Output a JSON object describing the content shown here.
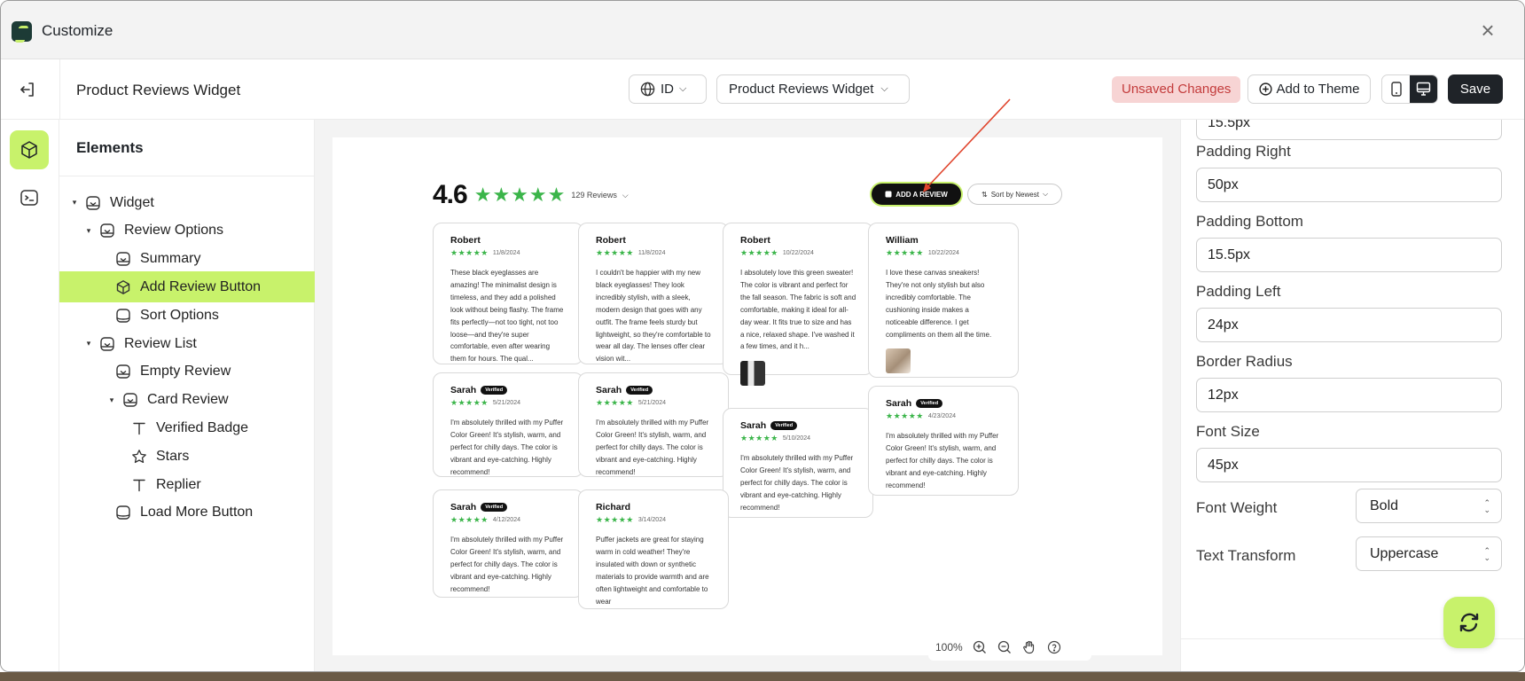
{
  "window": {
    "title": "Customize"
  },
  "header": {
    "widget_title": "Product Reviews Widget",
    "language": "ID",
    "widget_select": "Product Reviews Widget",
    "unsaved_label": "Unsaved Changes",
    "add_to_theme_label": "Add to Theme",
    "save_label": "Save"
  },
  "elements_panel": {
    "title": "Elements",
    "items": [
      {
        "label": "Widget",
        "level": 0,
        "expandable": true,
        "icon": "widget-icon"
      },
      {
        "label": "Review Options",
        "level": 1,
        "expandable": true,
        "icon": "widget-icon"
      },
      {
        "label": "Summary",
        "level": 2,
        "expandable": false,
        "icon": "widget-icon"
      },
      {
        "label": "Add Review Button",
        "level": 2,
        "expandable": false,
        "icon": "cube-icon",
        "selected": true
      },
      {
        "label": "Sort Options",
        "level": 2,
        "expandable": false,
        "icon": "container-icon"
      },
      {
        "label": "Review List",
        "level": 1,
        "expandable": true,
        "icon": "widget-icon"
      },
      {
        "label": "Empty Review",
        "level": 2,
        "expandable": false,
        "icon": "widget-icon"
      },
      {
        "label": "Card Review",
        "level": 2,
        "expandable": true,
        "icon": "widget-icon"
      },
      {
        "label": "Verified Badge",
        "level": 3,
        "expandable": false,
        "icon": "text-icon"
      },
      {
        "label": "Stars",
        "level": 3,
        "expandable": false,
        "icon": "star-icon"
      },
      {
        "label": "Replier",
        "level": 3,
        "expandable": false,
        "icon": "text-icon"
      },
      {
        "label": "Load More Button",
        "level": 2,
        "expandable": false,
        "icon": "container-icon"
      }
    ]
  },
  "preview": {
    "rating": "4.6",
    "stars": "★★★★★",
    "reviews_count": "129 Reviews",
    "add_review_label": "ADD A REVIEW",
    "sort_label": "Sort by Newest",
    "verified_label": "Verified",
    "cards": [
      {
        "name": "Robert",
        "stars": "★★★★★",
        "date": "11/8/2024",
        "verified": false,
        "body": "These black eyeglasses are amazing! The minimalist design is timeless, and they add a polished look without being flashy. The frame fits perfectly—not too tight, not too loose—and they're super comfortable, even after wearing them for hours. The qual..."
      },
      {
        "name": "Robert",
        "stars": "★★★★★",
        "date": "11/8/2024",
        "verified": false,
        "body": "I couldn't be happier with my new black eyeglasses! They look incredibly stylish, with a sleek, modern design that goes with any outfit. The frame feels sturdy but lightweight, so they're comfortable to wear all day. The lenses offer clear vision wit..."
      },
      {
        "name": "Robert",
        "stars": "★★★★★",
        "date": "10/22/2024",
        "verified": false,
        "body": "I absolutely love this green sweater! The color is vibrant and perfect for the fall season. The fabric is soft and comfortable, making it ideal for all-day wear. It fits true to size and has a nice, relaxed shape. I've washed it a few times, and it h..."
      },
      {
        "name": "William",
        "stars": "★★★★★",
        "date": "10/22/2024",
        "verified": false,
        "body": "I love these canvas sneakers! They're not only stylish but also incredibly comfortable. The cushioning inside makes a noticeable difference. I get compliments on them all the time."
      },
      {
        "name": "Sarah",
        "stars": "★★★★★",
        "date": "5/21/2024",
        "verified": true,
        "body": "I'm absolutely thrilled with my Puffer Color Green! It's stylish, warm, and perfect for chilly days. The color is vibrant and eye-catching. Highly recommend!"
      },
      {
        "name": "Sarah",
        "stars": "★★★★★",
        "date": "5/21/2024",
        "verified": true,
        "body": "I'm absolutely thrilled with my Puffer Color Green! It's stylish, warm, and perfect for chilly days. The color is vibrant and eye-catching. Highly recommend!"
      },
      {
        "name": "Sarah",
        "stars": "★★★★★",
        "date": "5/10/2024",
        "verified": true,
        "body": "I'm absolutely thrilled with my Puffer Color Green! It's stylish, warm, and perfect for chilly days. The color is vibrant and eye-catching. Highly recommend!"
      },
      {
        "name": "Sarah",
        "stars": "★★★★★",
        "date": "4/23/2024",
        "verified": true,
        "body": "I'm absolutely thrilled with my Puffer Color Green! It's stylish, warm, and perfect for chilly days. The color is vibrant and eye-catching. Highly recommend!"
      },
      {
        "name": "Sarah",
        "stars": "★★★★★",
        "date": "4/12/2024",
        "verified": true,
        "body": "I'm absolutely thrilled with my Puffer Color Green! It's stylish, warm, and perfect for chilly days. The color is vibrant and eye-catching. Highly recommend!"
      },
      {
        "name": "Richard",
        "stars": "★★★★★",
        "date": "3/14/2024",
        "verified": false,
        "body": "Puffer jackets are great for staying warm in cold weather! They're insulated with down or synthetic materials to provide warmth and are often lightweight and comfortable to wear"
      }
    ],
    "zoom_level": "100%"
  },
  "properties": {
    "top_value": "15.5px",
    "fields": [
      {
        "label": "Padding Right",
        "value": "50px"
      },
      {
        "label": "Padding Bottom",
        "value": "15.5px"
      },
      {
        "label": "Padding Left",
        "value": "24px"
      },
      {
        "label": "Border Radius",
        "value": "12px"
      },
      {
        "label": "Font Size",
        "value": "45px"
      }
    ],
    "font_weight_label": "Font Weight",
    "font_weight_value": "Bold",
    "text_transform_label": "Text Transform",
    "text_transform_value": "Uppercase"
  },
  "colors": {
    "accent": "#c8f26b",
    "star_green": "#3bb54a",
    "dark": "#1f2328",
    "unsaved_bg": "#f7d4d4",
    "unsaved_text": "#c33b3b",
    "annotation_arrow": "#e0442c"
  }
}
